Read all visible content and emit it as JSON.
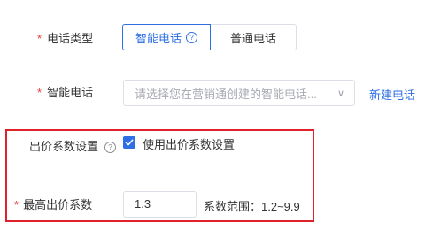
{
  "phone_type": {
    "required_mark": "*",
    "label": "电话类型",
    "options": {
      "smart": "智能电话",
      "normal": "普通电话"
    },
    "help_glyph": "?"
  },
  "smart_phone": {
    "required_mark": "*",
    "label": "智能电话",
    "placeholder": "请选择您在营销通创建的智能电话...",
    "chevron": "∨",
    "new_link": "新建电话"
  },
  "bid_setting": {
    "label": "出价系数设置",
    "help_glyph": "?",
    "checkbox_label": "使用出价系数设置",
    "checked": true
  },
  "max_coefficient": {
    "required_mark": "*",
    "label": "最高出价系数",
    "value": "1.3",
    "range_text": "系数范围：1.2~9.9"
  },
  "colors": {
    "accent": "#2f6fe4",
    "required": "#e63b3b",
    "highlight_border": "#e0202a"
  },
  "icons": [
    "help-circle-icon",
    "chevron-down-icon",
    "checkmark-icon"
  ]
}
